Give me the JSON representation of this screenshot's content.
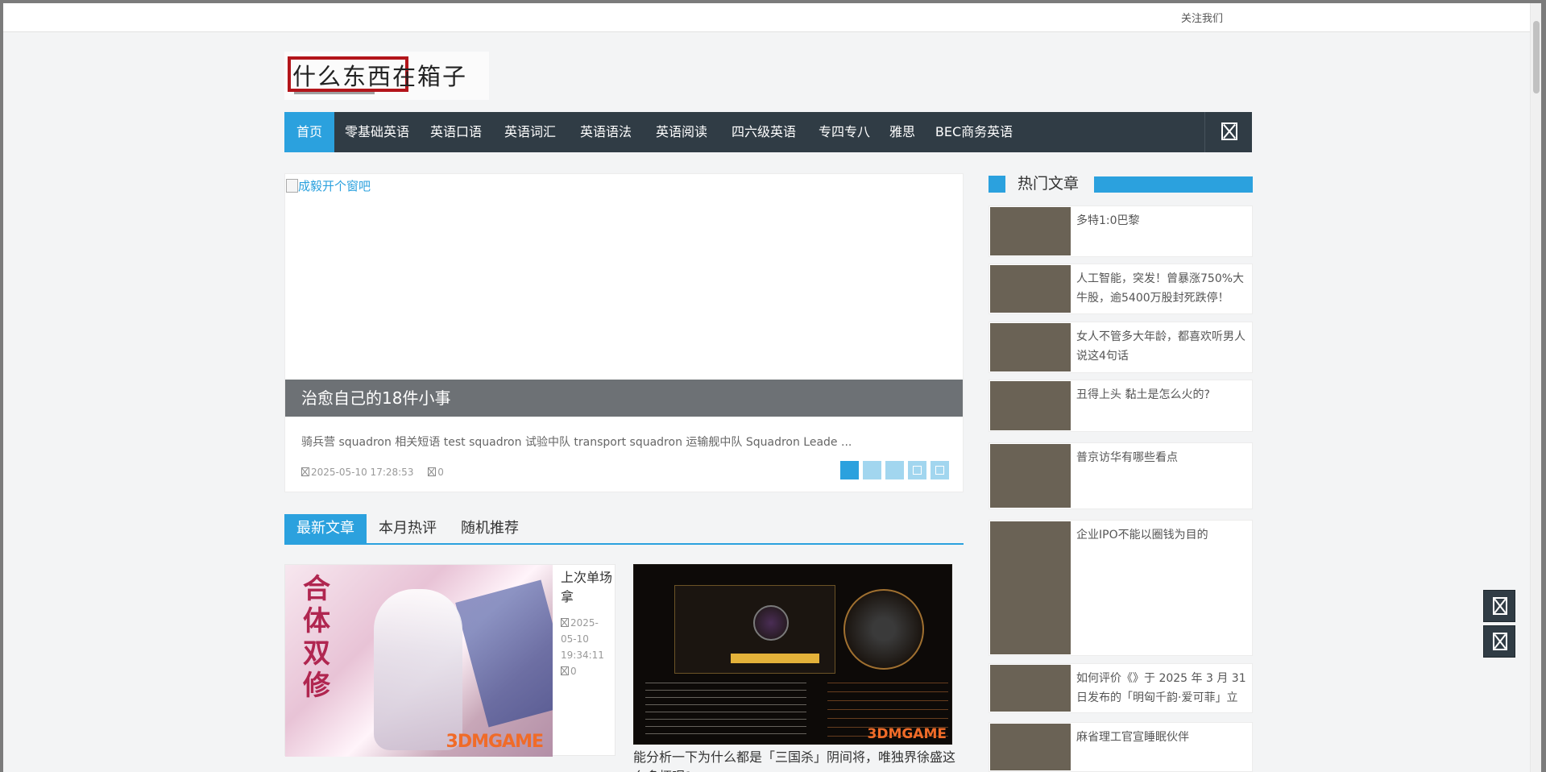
{
  "topbar": {
    "follow_label": "关注我们"
  },
  "logo": {
    "text": "什么东西在箱子"
  },
  "nav": {
    "items": [
      {
        "label": "首页",
        "active": true
      },
      {
        "label": "零基础英语"
      },
      {
        "label": "英语口语"
      },
      {
        "label": "英语词汇"
      },
      {
        "label": "英语语法"
      },
      {
        "label": "英语阅读"
      },
      {
        "label": "四六级英语"
      },
      {
        "label": "专四专八"
      },
      {
        "label": "雅思"
      },
      {
        "label": "BEC商务英语"
      }
    ],
    "search_icon": "search-icon"
  },
  "slider": {
    "image_alt": "成毅开个窗吧",
    "caption": "治愈自己的18件小事",
    "excerpt": "骑兵营    squadron 相关短语    test squadron 试验中队 transport squadron 运输舰中队 Squadron Leade ...",
    "date": "2025-05-10 17:28:53",
    "comments": "0",
    "dots": 5,
    "active_dot": 0
  },
  "tabs": {
    "items": [
      {
        "label": "最新文章",
        "active": true
      },
      {
        "label": "本月热评"
      },
      {
        "label": "随机推荐"
      }
    ]
  },
  "posts": [
    {
      "title": "上次单场拿",
      "date": "2025-05-10 19:34:11",
      "comments": "0",
      "thumb_title": "合体双修",
      "watermark": "3DMGAME"
    },
    {
      "title": "能分析一下为什么都是「三国杀」阴间将，唯独界徐盛这么多梗呢?",
      "watermark": "3DMGAME"
    }
  ],
  "sidebar": {
    "title": "热门文章",
    "items": [
      {
        "title": "多特1:0巴黎"
      },
      {
        "title": "人工智能，突发！曾暴涨750%大牛股，逾5400万股封死跌停！"
      },
      {
        "title": "女人不管多大年龄，都喜欢听男人说这4句话"
      },
      {
        "title": "丑得上头 黏土是怎么火的?"
      },
      {
        "title": "普京访华有哪些看点"
      },
      {
        "title": "企业IPO不能以圈钱为目的"
      },
      {
        "title": "如何评价《》于 2025 年 3 月 31 日发布的「明匈千韵·爱可菲」立"
      },
      {
        "title": "麻省理工官宣睡眠伙伴"
      }
    ]
  },
  "floating_buttons": [
    "share-icon",
    "back-to-top-icon"
  ]
}
